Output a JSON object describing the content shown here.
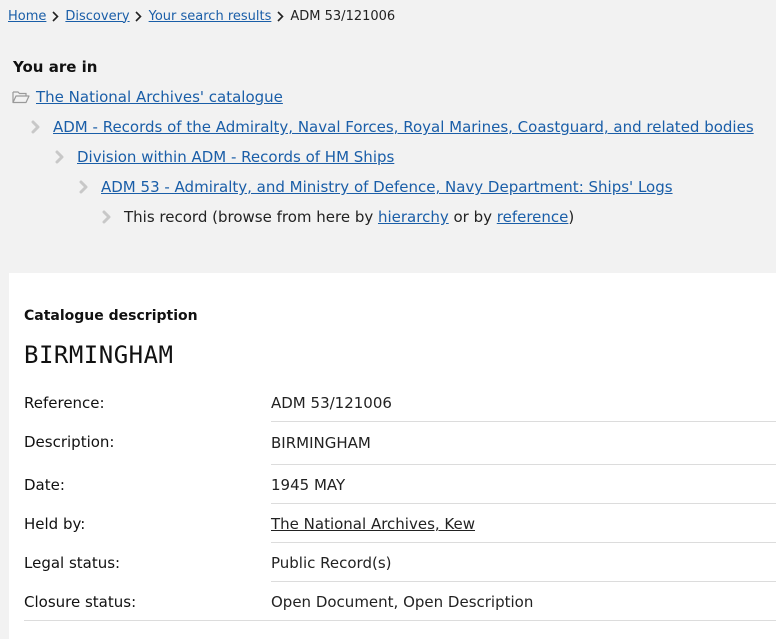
{
  "breadcrumb": {
    "items": [
      "Home",
      "Discovery",
      "Your search results"
    ],
    "current": "ADM 53/121006"
  },
  "you_are_in": {
    "title": "You are in",
    "level0": "The National Archives' catalogue",
    "level1": "ADM - Records of the Admiralty, Naval Forces, Royal Marines, Coastguard, and related bodies",
    "level2": "Division within ADM - Records of HM Ships",
    "level3": "ADM 53 - Admiralty, and Ministry of Defence, Navy Department: Ships' Logs",
    "level4": {
      "prefix": "This record (browse from here by ",
      "hierarchy_link": "hierarchy",
      "middle": " or by ",
      "reference_link": "reference",
      "suffix": ")"
    }
  },
  "catalogue": {
    "section_label": "Catalogue description",
    "title": "BIRMINGHAM",
    "fields": {
      "reference_label": "Reference:",
      "reference_value": "ADM 53/121006",
      "description_label": "Description:",
      "description_value": "BIRMINGHAM",
      "date_label": "Date:",
      "date_value": "1945 MAY",
      "held_by_label": "Held by:",
      "held_by_value": "The National Archives, Kew",
      "legal_status_label": "Legal status:",
      "legal_status_value": "Public Record(s)",
      "closure_status_label": "Closure status:",
      "closure_status_value": "Open Document, Open Description"
    }
  },
  "colors": {
    "link": "#1a5ea8",
    "background": "#f2f2f2",
    "panel": "#ffffff",
    "chevron": "#c8c8c8"
  },
  "icons": {
    "breadcrumb_separator": "chevron-right-icon",
    "tree_root": "folder-open-icon",
    "tree_level": "arrow-right-icon"
  }
}
